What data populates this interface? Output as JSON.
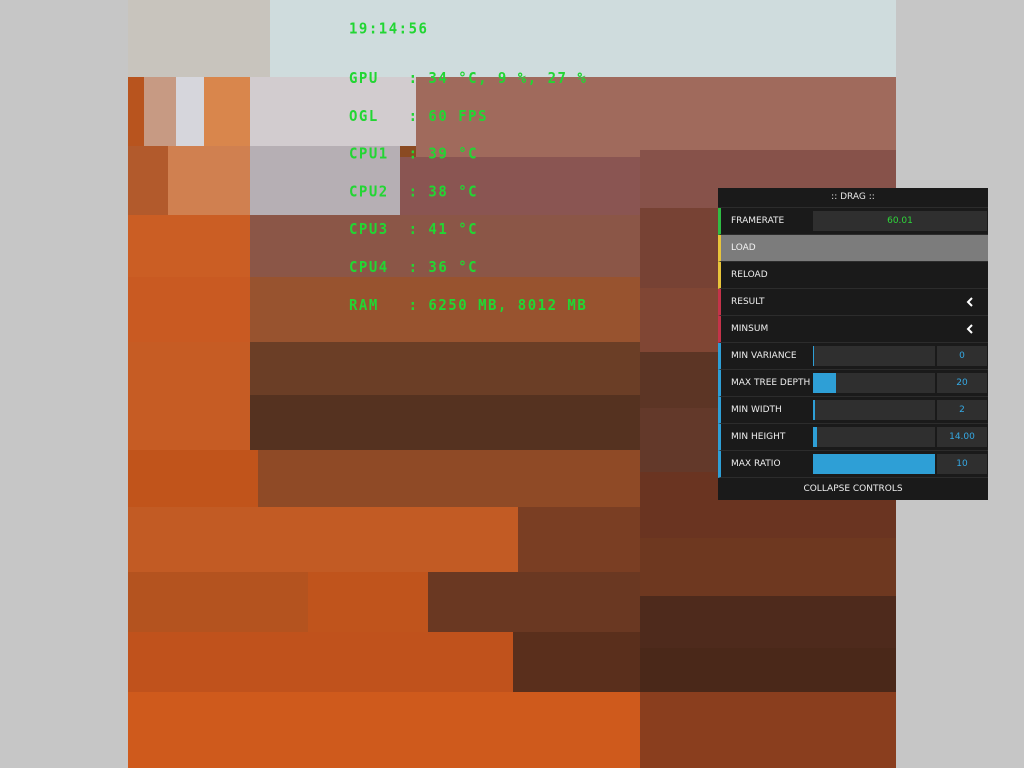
{
  "hud": {
    "time": "19:14:56",
    "lines": [
      "GPU   : 34 °C, 9 %, 27 %",
      "OGL   : 60 FPS",
      "CPU1  : 39 °C",
      "CPU2  : 38 °C",
      "CPU3  : 41 °C",
      "CPU4  : 36 °C",
      "RAM   : 6250 MB, 8012 MB"
    ]
  },
  "panel": {
    "title": ":: DRAG ::",
    "framerate_label": "FRAMERATE",
    "framerate_value": "60.01",
    "load_label": "LOAD",
    "reload_label": "RELOAD",
    "result_label": "RESULT",
    "minsum_label": "MINSUM",
    "sliders": [
      {
        "label": "MIN VARIANCE",
        "value": "0",
        "fraction": 0.0
      },
      {
        "label": "MAX TREE DEPTH",
        "value": "20",
        "fraction": 0.19
      },
      {
        "label": "MIN WIDTH",
        "value": "2",
        "fraction": 0.01
      },
      {
        "label": "MIN HEIGHT",
        "value": "14.00",
        "fraction": 0.03
      },
      {
        "label": "MAX RATIO",
        "value": "10",
        "fraction": 1.0
      }
    ],
    "collapse_label": "COLLAPSE CONTROLS"
  },
  "colors": {
    "hud_text": "#22d633",
    "panel_bg": "#1a1a1a",
    "accent_blue": "#2e9fd6",
    "accent_green": "#2fbc44",
    "accent_yellow": "#e8c43a",
    "accent_red": "#c4334a"
  }
}
